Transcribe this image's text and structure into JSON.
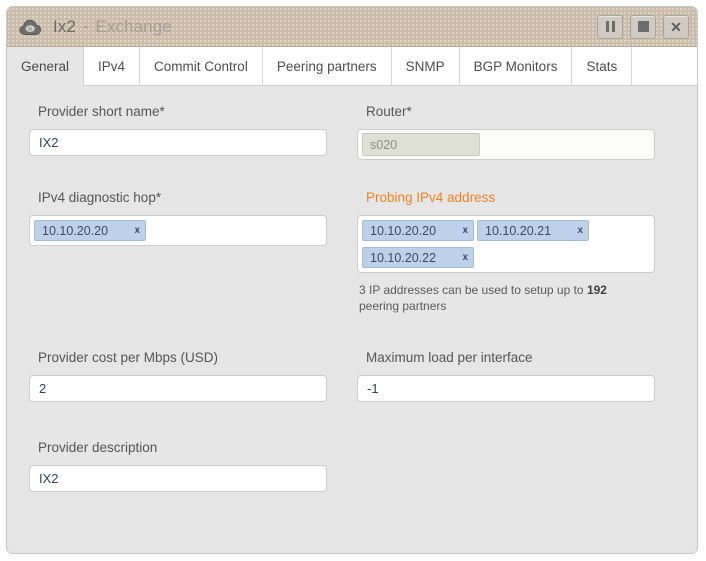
{
  "window": {
    "icon": "cloud-ix-icon",
    "title_name": "Ix2",
    "title_separator": "-",
    "title_subtitle": "Exchange",
    "controls": [
      {
        "name": "pause-button",
        "icon": "pause-icon",
        "label": ""
      },
      {
        "name": "stop-button",
        "icon": "stop-icon",
        "label": ""
      },
      {
        "name": "close-button",
        "icon": "close-icon",
        "label": "✕"
      }
    ]
  },
  "tabs": [
    {
      "label": "General",
      "active": true
    },
    {
      "label": "IPv4",
      "active": false
    },
    {
      "label": "Commit Control",
      "active": false
    },
    {
      "label": "Peering partners",
      "active": false
    },
    {
      "label": "SNMP",
      "active": false
    },
    {
      "label": "BGP Monitors",
      "active": false
    },
    {
      "label": "Stats",
      "active": false
    }
  ],
  "form": {
    "provider_short_name": {
      "label": "Provider short name*",
      "value": "IX2"
    },
    "router": {
      "label": "Router*",
      "token": "s020"
    },
    "ipv4_diagnostic_hop": {
      "label": "IPv4 diagnostic hop*",
      "tokens": [
        "10.10.20.20"
      ],
      "remove_glyph": "x"
    },
    "probing_ipv4_address": {
      "label": "Probing IPv4 address",
      "label_color": "#f0821e",
      "tokens": [
        "10.10.20.20",
        "10.10.20.21",
        "10.10.20.22"
      ],
      "remove_glyph": "x",
      "hint_prefix": "3 IP addresses can be used to setup up to ",
      "hint_strong": "192",
      "hint_suffix": " peering partners"
    },
    "provider_cost": {
      "label": "Provider cost per Mbps (USD)",
      "value": "2"
    },
    "maximum_load": {
      "label": "Maximum load per interface",
      "value": "-1"
    },
    "provider_description": {
      "label": "Provider description",
      "value": "IX2"
    }
  }
}
